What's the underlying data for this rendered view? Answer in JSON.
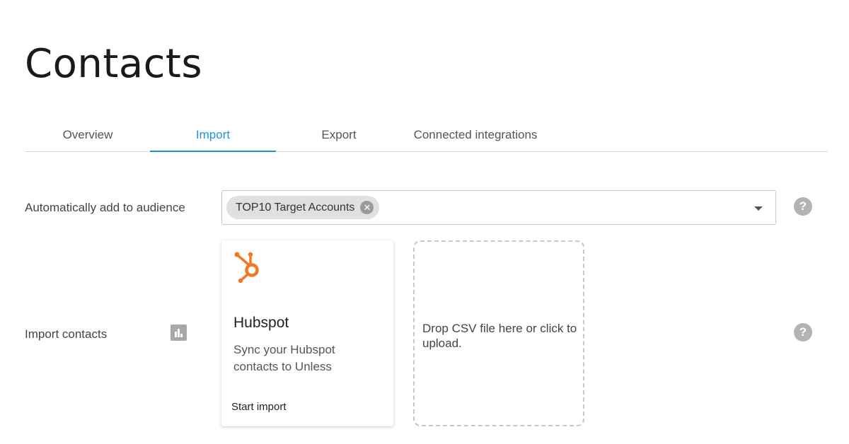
{
  "page": {
    "title": "Contacts"
  },
  "tabs": [
    {
      "label": "Overview",
      "active": false
    },
    {
      "label": "Import",
      "active": true
    },
    {
      "label": "Export",
      "active": false
    },
    {
      "label": "Connected integrations",
      "active": false
    }
  ],
  "audience": {
    "label": "Automatically add to audience",
    "selected_chip": "TOP10 Target Accounts",
    "chip_remove_icon": "close-circle-icon",
    "caret_icon": "caret-down-icon",
    "help_icon": "question-icon"
  },
  "import_contacts": {
    "label": "Import contacts",
    "stats_icon": "bar-chart-icon",
    "help_icon": "question-icon",
    "hubspot_card": {
      "logo_icon": "hubspot-logo-icon",
      "title": "Hubspot",
      "description": "Sync your Hubspot contacts to Unless",
      "action": "Start import"
    },
    "dropzone": {
      "text": "Drop CSV file here or click to upload."
    }
  },
  "colors": {
    "accent": "#1a96d6",
    "hubspot_orange": "#f57722",
    "chip_bg": "#e0e0e0",
    "icon_gray": "#b3b3b3"
  }
}
